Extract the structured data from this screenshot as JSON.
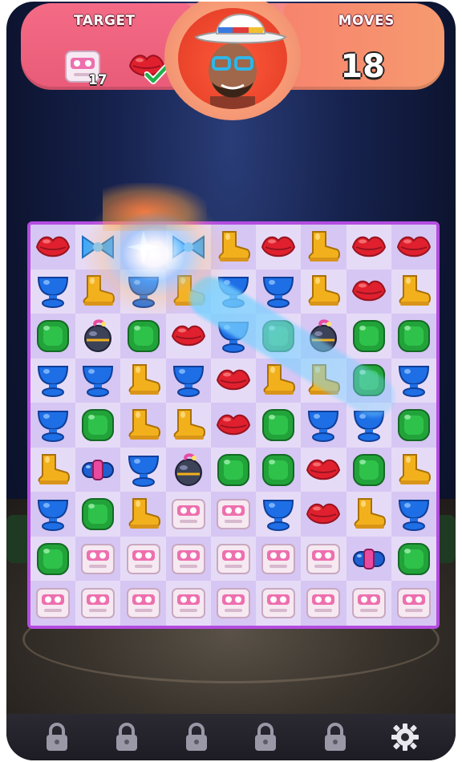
{
  "hud": {
    "target_label": "TARGET",
    "moves_label": "MOVES",
    "moves_value": "18",
    "target_item": "cassette-tile",
    "target_count": "17",
    "completed_item": "lips-candy",
    "completed_icon": "check-icon"
  },
  "board": {
    "rows": [
      [
        "lips",
        "bow",
        "sparkle",
        "bow",
        "boot",
        "lips",
        "boot",
        "lips",
        "lips"
      ],
      [
        "cup",
        "boot",
        "cup",
        "boot",
        "cup",
        "cup",
        "boot",
        "lips",
        "boot"
      ],
      [
        "square",
        "bomb",
        "square",
        "lips",
        "cup",
        "square",
        "bomb",
        "square",
        "square"
      ],
      [
        "cup",
        "cup",
        "boot",
        "cup",
        "lips",
        "boot",
        "boot",
        "square",
        "cup"
      ],
      [
        "cup",
        "square",
        "boot",
        "boot",
        "lips",
        "square",
        "cup",
        "cup",
        "square"
      ],
      [
        "boot",
        "rocket",
        "cup",
        "bomb",
        "square",
        "square",
        "lips",
        "square",
        "boot"
      ],
      [
        "cup",
        "square",
        "boot",
        "cassette",
        "cassette",
        "cup",
        "lips",
        "boot",
        "cup"
      ],
      [
        "square",
        "cassette",
        "cassette",
        "cassette",
        "cassette",
        "cassette",
        "cassette",
        "rocket",
        "square"
      ],
      [
        "cassette",
        "cassette",
        "cassette",
        "cassette",
        "cassette",
        "cassette",
        "cassette",
        "cassette",
        "cassette"
      ]
    ]
  },
  "colors": {
    "lips": "#e0202e",
    "cup": "#1e6fe6",
    "boot": "#f2b11c",
    "square": "#22a33a",
    "board_border": "#b44de0"
  },
  "bottom_bar": {
    "slots": [
      "lock-icon",
      "lock-icon",
      "lock-icon",
      "lock-icon",
      "lock-icon",
      "gear-icon"
    ]
  }
}
